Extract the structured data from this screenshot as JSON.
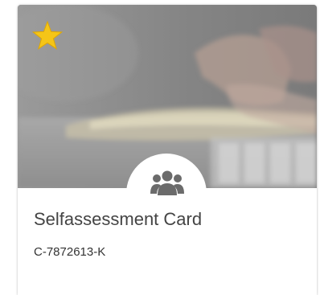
{
  "card": {
    "title": "Selfassessment Card",
    "code": "C-7872613-K",
    "favorite": true,
    "favorite_icon": "star-icon",
    "badge_icon": "users-group-icon",
    "colors": {
      "star": "#f5c518",
      "icon": "#6b6b6b",
      "title": "#444444"
    }
  }
}
